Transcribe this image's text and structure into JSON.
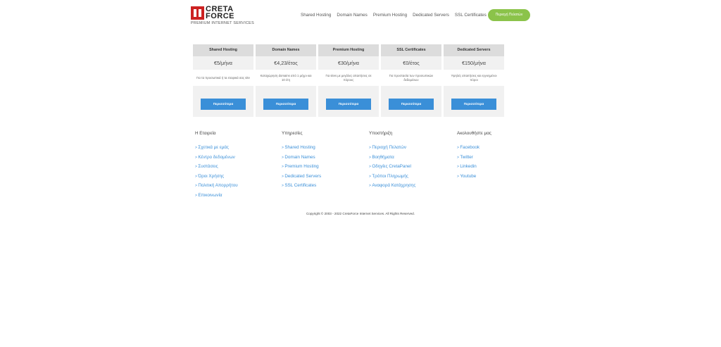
{
  "header": {
    "logo_line1": "CRETA",
    "logo_line2": "FORCE",
    "logo_tagline": "PREMIUM INTERNET SERVICES",
    "nav": [
      "Shared Hosting",
      "Domain Names",
      "Premium Hosting",
      "Dedicated Servers",
      "SSL Certificates"
    ],
    "client_area": "Περιοχή Πελατών"
  },
  "cards": [
    {
      "title": "Shared Hosting",
      "price": "€5/μήνα",
      "desc": "Για τα προσωπικά ή τα εταιρικά σας site",
      "button": "Περισσότερα"
    },
    {
      "title": "Domain Names",
      "price": "€4,23/έτος",
      "desc": "Καταχώρηση domains από 1 μέχρι και 10 έτη",
      "button": "Περισσότερα"
    },
    {
      "title": "Premium Hosting",
      "price": "€30/μήνα",
      "desc": "Για sites με μεγάλες απαιτήσεις σε πόρους",
      "button": "Περισσότερα"
    },
    {
      "title": "SSL Certificates",
      "price": "€0/έτος",
      "desc": "Για προστασία των προσωπικών δεδομένων",
      "button": "Περισσότερα"
    },
    {
      "title": "Dedicated Servers",
      "price": "€150/μήνα",
      "desc": "Υψηλές απαιτήσεις και εγγυημένοι πόροι",
      "button": "Περισσότερα"
    }
  ],
  "footer": {
    "company": {
      "heading": "Η Εταιρεία",
      "links": [
        "Σχετικά με εμάς",
        "Κέντρο δεδομένων",
        "Συστάσεις",
        "Όροι Χρήσης",
        "Πολιτική Απορρήτου",
        "Επικοινωνία"
      ]
    },
    "services": {
      "heading": "Υπηρεσίες",
      "links": [
        "Shared Hosting",
        "Domain Names",
        "Premium Hosting",
        "Dedicated Servers",
        "SSL Certificates"
      ]
    },
    "support": {
      "heading": "Υποστήριξη",
      "links": [
        "Περιοχή Πελατών",
        "Βοηθήματα",
        "Οδηγίες CretaPanel",
        "Τρόποι Πληρωμής",
        "Αναφορά Κατάχρησης"
      ]
    },
    "follow": {
      "heading": "Ακολουθήστε μας",
      "links": [
        "Facebook",
        "Twitter",
        "Linkedin",
        "Youtube"
      ]
    }
  },
  "copyright": "Copyright © 2003 - 2022 CretaForce Internet Services. All Rights Reserved."
}
